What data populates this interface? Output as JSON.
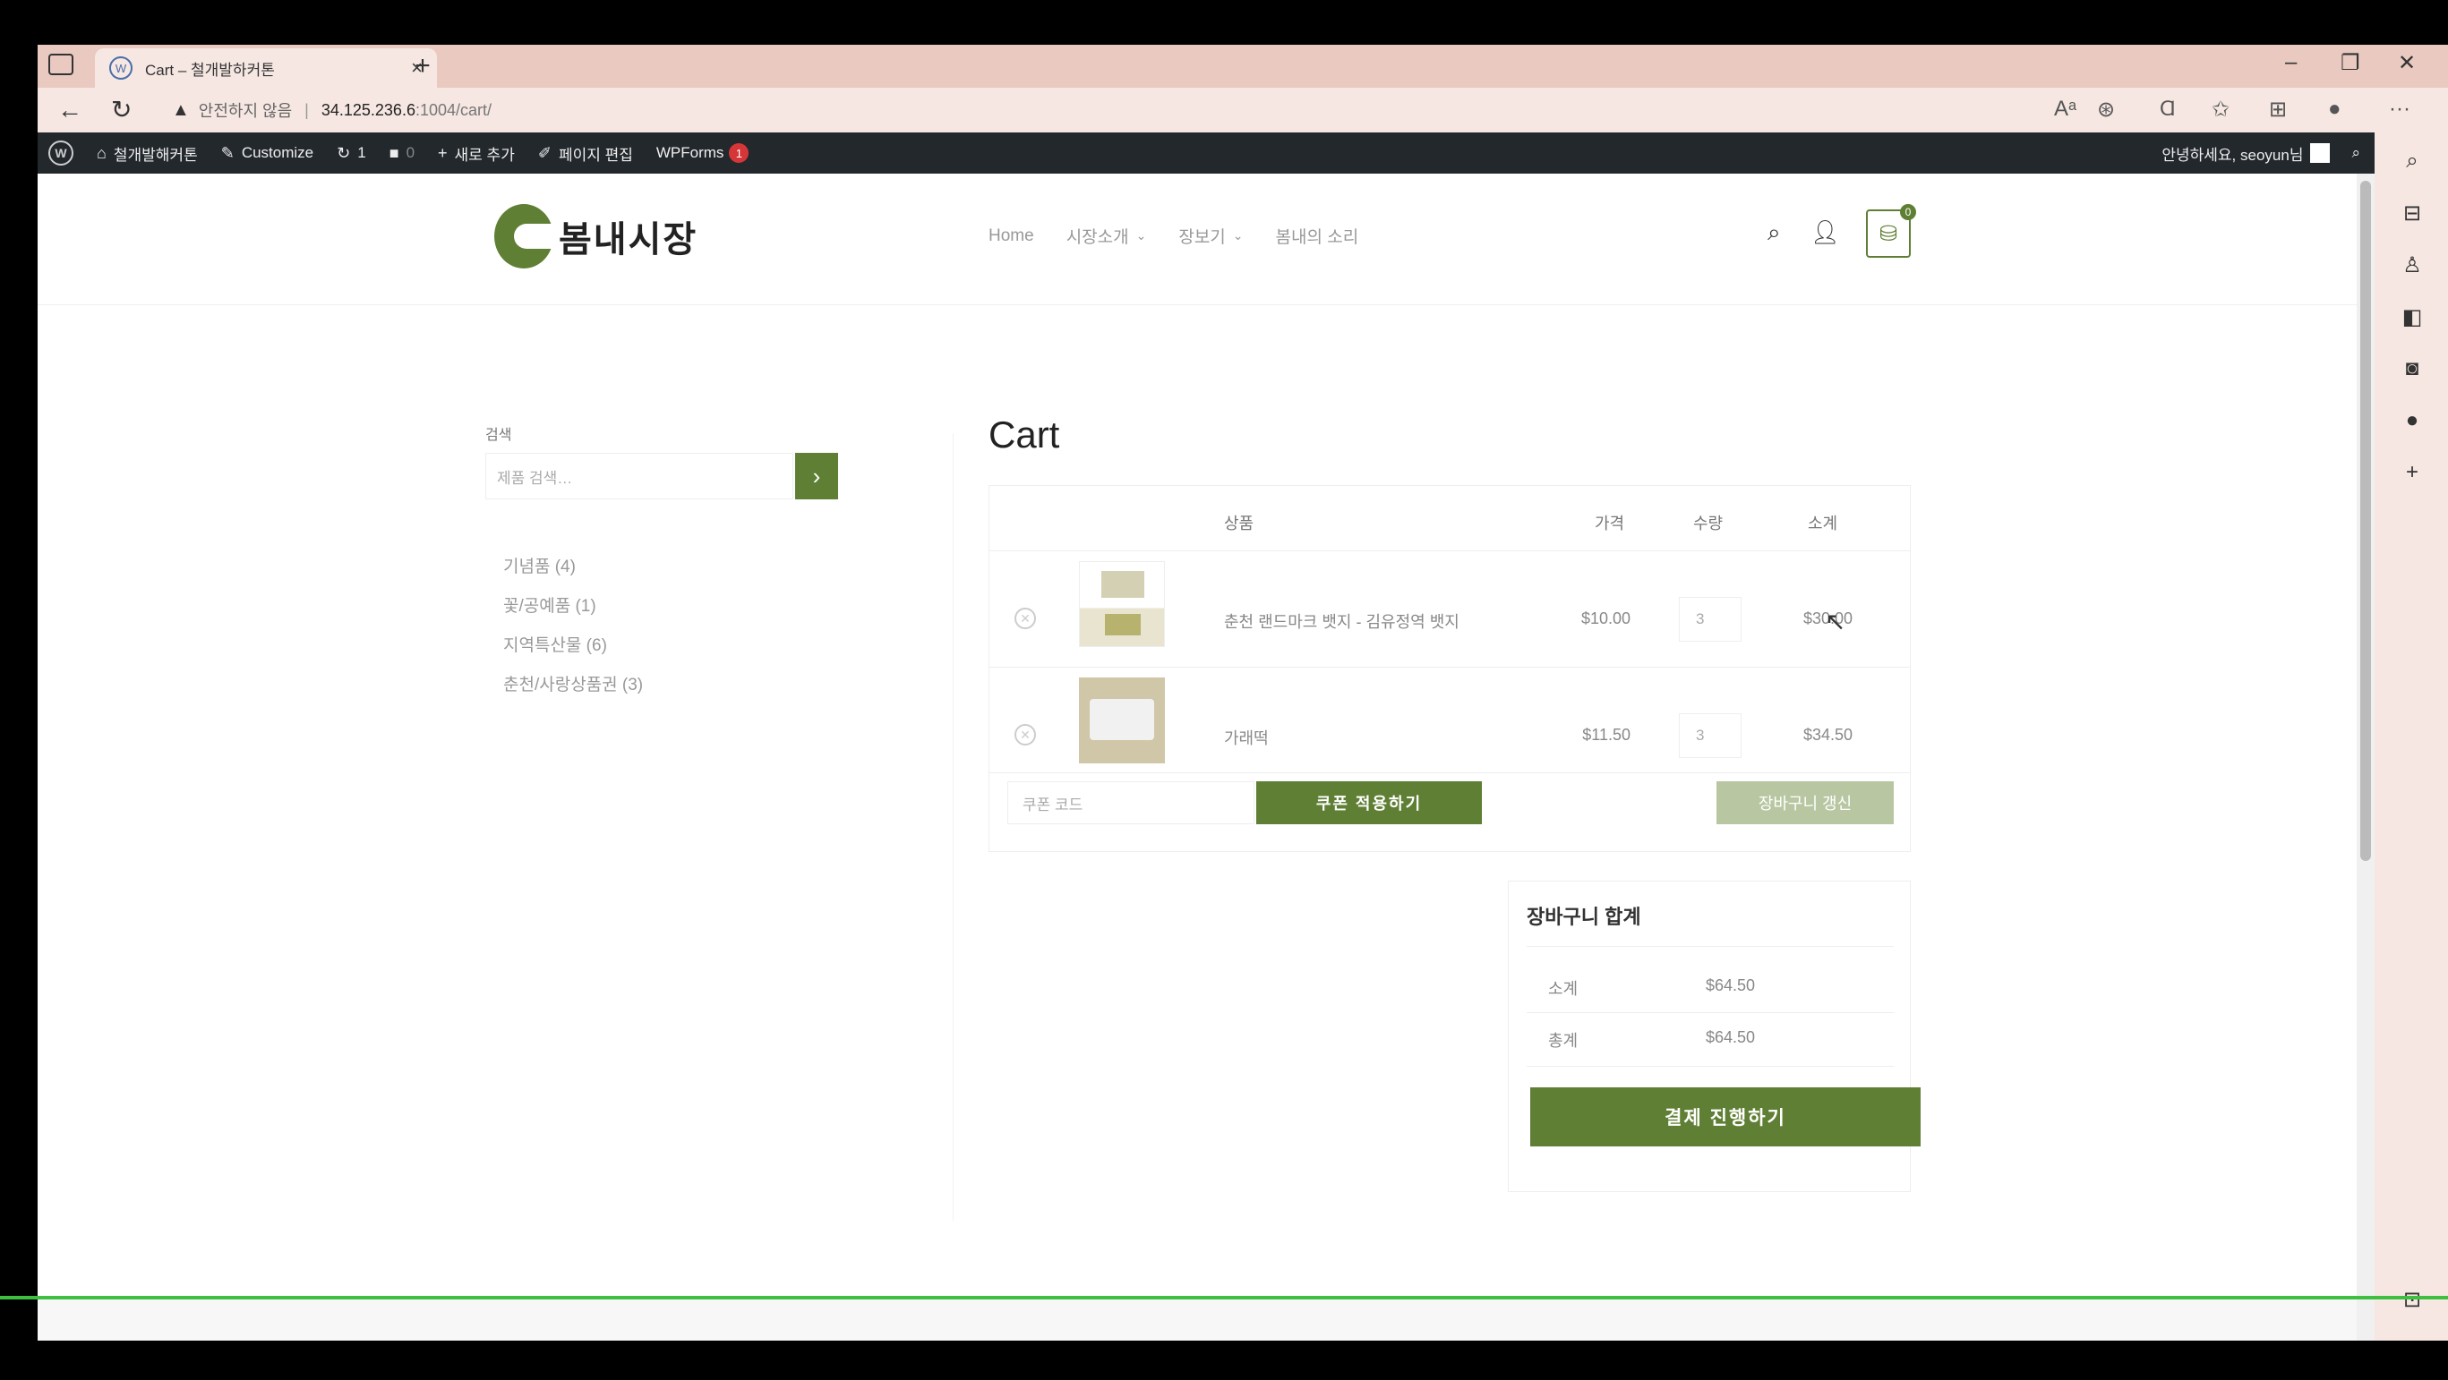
{
  "browser": {
    "tab_title": "Cart – 철개발하커톤",
    "tab_close": "×",
    "new_tab": "+",
    "insecure_label": "안전하지 않음",
    "url_separator": "|",
    "url_host": "34.125.236.6",
    "url_path": ":1004/cart/",
    "more": "···"
  },
  "wp_admin_bar": {
    "site_name": "철개발해커톤",
    "customize": "Customize",
    "updates_count": "1",
    "comments_count": "0",
    "new_label": "새로 추가",
    "edit_page": "페이지 편집",
    "wpforms": "WPForms",
    "wpforms_badge": "1",
    "greeting": "안녕하세요, seoyun님"
  },
  "site": {
    "logo_text": "봄내시장",
    "nav": [
      {
        "label": "Home"
      },
      {
        "label": "시장소개"
      },
      {
        "label": "장보기"
      },
      {
        "label": "봄내의 소리"
      }
    ],
    "cart_count": "0"
  },
  "sidebar": {
    "search_title": "검색",
    "search_placeholder": "제품 검색…",
    "categories": [
      "기념품 (4)",
      "꽃/공예품 (1)",
      "지역특산물 (6)",
      "춘천/사랑상품권 (3)"
    ]
  },
  "cart": {
    "title": "Cart",
    "headers": {
      "product": "상품",
      "price": "가격",
      "qty": "수량",
      "subtotal": "소계"
    },
    "items": [
      {
        "name": "춘천 랜드마크 뱃지 - 김유정역 뱃지",
        "price": "$10.00",
        "qty": "3",
        "subtotal": "$30.00"
      },
      {
        "name": "가래떡",
        "price": "$11.50",
        "qty": "3",
        "subtotal": "$34.50"
      }
    ],
    "coupon_placeholder": "쿠폰 코드",
    "apply_coupon": "쿠폰 적용하기",
    "update_cart": "장바구니 갱신"
  },
  "totals": {
    "title": "장바구니 합계",
    "subtotal_label": "소계",
    "subtotal_value": "$64.50",
    "total_label": "총계",
    "total_value": "$64.50",
    "checkout": "결제 진행하기"
  },
  "colors": {
    "brand_green": "#5f7f34",
    "admin_bar": "#23282d",
    "tab_bar": "#e9c9c0"
  }
}
